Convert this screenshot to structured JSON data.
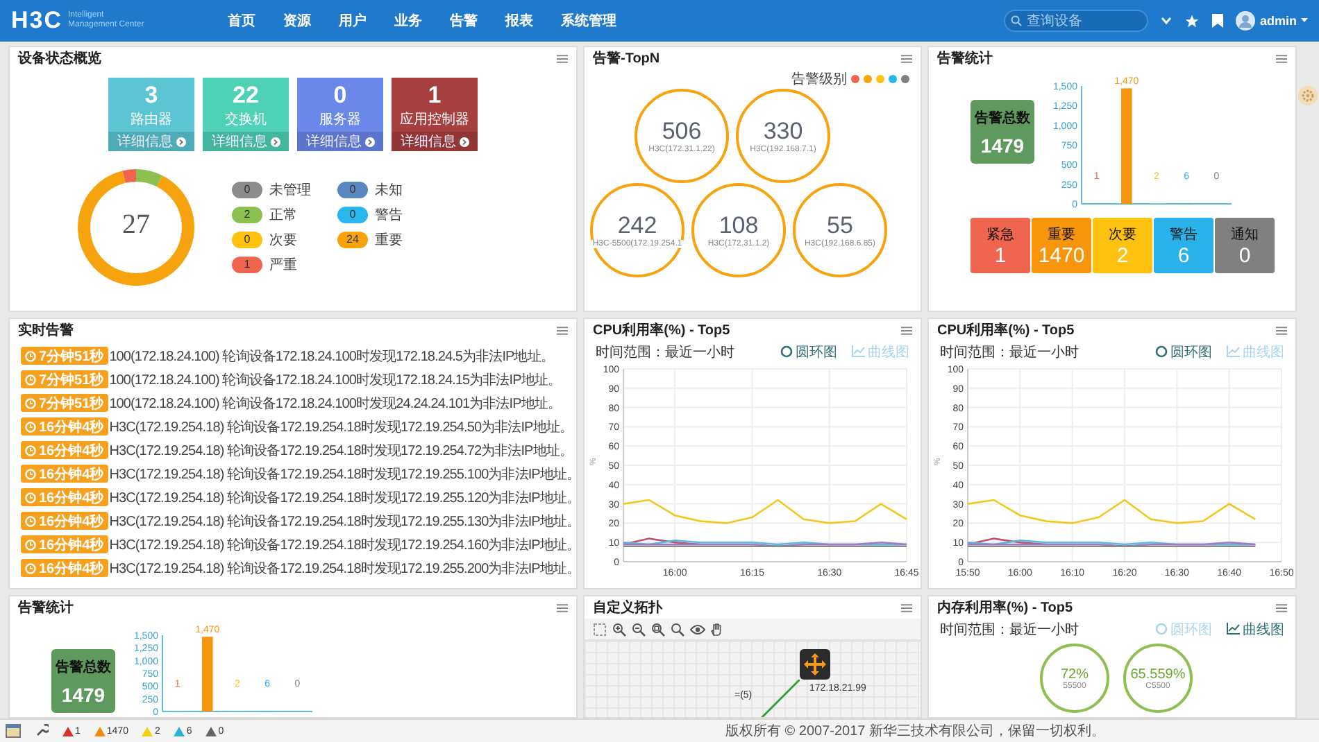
{
  "header": {
    "logo": "H3C",
    "logo_line_1": "Intelligent",
    "logo_line_2": "Management Center",
    "nav": [
      "首页",
      "资源",
      "用户",
      "业务",
      "告警",
      "报表",
      "系统管理"
    ],
    "search": {
      "placeholder": "查询设备"
    },
    "user": "admin"
  },
  "device_overview": {
    "title": "设备状态概览",
    "tiles": [
      {
        "count": "3",
        "label": "路由器",
        "link": "详细信息",
        "color": "#5bc5d3"
      },
      {
        "count": "22",
        "label": "交换机",
        "link": "详细信息",
        "color": "#4ed1b5"
      },
      {
        "count": "0",
        "label": "服务器",
        "link": "详细信息",
        "color": "#6a87ea"
      },
      {
        "count": "1",
        "label": "应用控制器",
        "link": "详细信息",
        "color": "#a83f3f"
      }
    ],
    "total": "27",
    "legend": [
      {
        "count": "0",
        "label": "未管理",
        "color": "#8c8c8c"
      },
      {
        "count": "0",
        "label": "未知",
        "color": "#5b87c0"
      },
      {
        "count": "2",
        "label": "正常",
        "color": "#8cc152"
      },
      {
        "count": "0",
        "label": "警告",
        "color": "#29b6ea"
      },
      {
        "count": "0",
        "label": "次要",
        "color": "#fdc20f"
      },
      {
        "count": "24",
        "label": "重要",
        "color": "#f7a30d"
      },
      {
        "count": "1",
        "label": "严重",
        "color": "#f0654f"
      }
    ]
  },
  "alarm_topn": {
    "title": "告警-TopN",
    "legend_label": "告警级别",
    "legend_dots": [
      {
        "color": "#f0654f"
      },
      {
        "color": "#f7a30d"
      },
      {
        "color": "#fdc20f"
      },
      {
        "color": "#29b6ea"
      },
      {
        "color": "#808080"
      }
    ],
    "devices": [
      {
        "count": "506",
        "name": "H3C(172.31.1.22)"
      },
      {
        "count": "330",
        "name": "H3C(192.168.7.1)"
      },
      {
        "count": "242",
        "name": "H3C-5500(172.19.254.1"
      },
      {
        "count": "108",
        "name": "H3C(172.31.1.2)"
      },
      {
        "count": "55",
        "name": "H3C(192.168.6.85)"
      }
    ]
  },
  "alarm_stats": {
    "title": "告警统计",
    "total_label": "告警总数",
    "total": "1479",
    "chart_data": {
      "type": "bar",
      "values": [
        1,
        1470,
        2,
        6,
        0
      ],
      "ylim": [
        0,
        1500
      ],
      "yticks": [
        0,
        250,
        500,
        750,
        {
          "value": 1000,
          "label": "1,000"
        },
        {
          "value": 1250,
          "label": "1,250"
        },
        {
          "value": 1500,
          "label": "1,500"
        }
      ],
      "value_labels": [
        "1",
        "1,470",
        "2",
        "6",
        "0"
      ]
    },
    "levels": [
      {
        "label": "紧急",
        "count": "1",
        "color": "#f0654f"
      },
      {
        "label": "重要",
        "count": "1470",
        "color": "#f7950d"
      },
      {
        "label": "次要",
        "count": "2",
        "color": "#fdc20f"
      },
      {
        "label": "警告",
        "count": "6",
        "color": "#29b1ea"
      },
      {
        "label": "通知",
        "count": "0",
        "color": "#808080"
      }
    ]
  },
  "realtime_alarms": {
    "title": "实时告警",
    "items": [
      {
        "age": "7分钟51秒",
        "message": "100(172.18.24.100) 轮询设备172.18.24.100时发现172.18.24.5为非法IP地址。"
      },
      {
        "age": "7分钟51秒",
        "message": "100(172.18.24.100) 轮询设备172.18.24.100时发现172.18.24.15为非法IP地址。"
      },
      {
        "age": "7分钟51秒",
        "message": "100(172.18.24.100) 轮询设备172.18.24.100时发现24.24.24.101为非法IP地址。"
      },
      {
        "age": "16分钟4秒",
        "message": "H3C(172.19.254.18) 轮询设备172.19.254.18时发现172.19.254.50为非法IP地址。"
      },
      {
        "age": "16分钟4秒",
        "message": "H3C(172.19.254.18) 轮询设备172.19.254.18时发现172.19.254.72为非法IP地址。"
      },
      {
        "age": "16分钟4秒",
        "message": "H3C(172.19.254.18) 轮询设备172.19.254.18时发现172.19.255.100为非法IP地址。"
      },
      {
        "age": "16分钟4秒",
        "message": "H3C(172.19.254.18) 轮询设备172.19.254.18时发现172.19.255.120为非法IP地址。"
      },
      {
        "age": "16分钟4秒",
        "message": "H3C(172.19.254.18) 轮询设备172.19.254.18时发现172.19.255.130为非法IP地址。"
      },
      {
        "age": "16分钟4秒",
        "message": "H3C(172.19.254.18) 轮询设备172.19.254.18时发现172.19.254.160为非法IP地址。"
      },
      {
        "age": "16分钟4秒",
        "message": "H3C(172.19.254.18) 轮询设备172.19.254.18时发现172.19.255.200为非法IP地址。"
      }
    ]
  },
  "cpu_panels": [
    {
      "title": "CPU利用率(%) - Top5",
      "time_range": "时间范围：最近一小时",
      "view_buttons": [
        {
          "label": "圆环图",
          "kind": "ring",
          "selected": false
        },
        {
          "label": "曲线图",
          "kind": "curve",
          "selected": true
        }
      ],
      "chart_data": {
        "type": "line",
        "grid": true,
        "ylabel": "%",
        "categories": [
          null,
          null,
          "16:00",
          null,
          null,
          "16:15",
          null,
          null,
          "16:30",
          null,
          null,
          "16:45"
        ],
        "ylim": [
          0,
          100
        ],
        "yticks": [
          0,
          10,
          20,
          30,
          40,
          50,
          60,
          70,
          80,
          90,
          100
        ],
        "series": [
          {
            "color": "#f2c81c",
            "values": [
              30,
              32,
              24,
              21,
              20,
              23,
              32,
              22,
              20,
              21,
              30,
              22
            ]
          },
          {
            "color": "#c0506e",
            "values": [
              9,
              12,
              10,
              9,
              null,
              null,
              null,
              null,
              null,
              null,
              null,
              null
            ]
          },
          {
            "color": "#5bb8e0",
            "values": [
              10,
              9,
              11,
              10,
              10,
              10,
              9,
              10,
              9,
              9,
              9,
              9
            ]
          },
          {
            "color": "#a07cc0",
            "values": [
              9,
              9,
              9,
              9,
              9,
              9,
              8,
              9,
              9,
              9,
              10,
              9
            ]
          },
          {
            "color": "#8a8a8a",
            "values": [
              8,
              8,
              8,
              8,
              8,
              8,
              8,
              8,
              8,
              8,
              8,
              8
            ]
          }
        ]
      }
    },
    {
      "title": "CPU利用率(%) - Top5",
      "time_range": "时间范围：最近一小时",
      "view_buttons": [
        {
          "label": "圆环图",
          "kind": "ring",
          "selected": false
        },
        {
          "label": "曲线图",
          "kind": "curve",
          "selected": true
        }
      ],
      "chart_data": {
        "type": "line",
        "grid": true,
        "ylabel": "%",
        "categories": [
          "15:50",
          null,
          "16:00",
          null,
          "16:10",
          null,
          "16:20",
          null,
          "16:30",
          null,
          "16:40",
          null,
          "16:50"
        ],
        "ylim": [
          0,
          100
        ],
        "yticks": [
          0,
          10,
          20,
          30,
          40,
          50,
          60,
          70,
          80,
          90,
          100
        ],
        "series": [
          {
            "color": "#f2c81c",
            "values": [
              30,
              32,
              24,
              21,
              20,
              23,
              32,
              22,
              20,
              21,
              30,
              22,
              null
            ]
          },
          {
            "color": "#c0506e",
            "values": [
              9,
              12,
              10,
              9,
              null,
              null,
              null,
              null,
              null,
              null,
              null,
              null,
              null
            ]
          },
          {
            "color": "#5bb8e0",
            "values": [
              10,
              9,
              11,
              10,
              10,
              10,
              9,
              10,
              9,
              9,
              9,
              9,
              null
            ]
          },
          {
            "color": "#a07cc0",
            "values": [
              9,
              9,
              9,
              9,
              9,
              9,
              8,
              9,
              9,
              9,
              10,
              9,
              null
            ]
          },
          {
            "color": "#8a8a8a",
            "values": [
              8,
              8,
              8,
              8,
              8,
              8,
              8,
              8,
              8,
              8,
              8,
              8,
              null
            ]
          }
        ]
      }
    }
  ],
  "alarm_stats_bottom": {
    "title": "告警统计",
    "total_label": "告警总数",
    "total": "1479",
    "chart_data": {
      "type": "bar",
      "values": [
        1,
        1470,
        2,
        6,
        0
      ],
      "ylim": [
        0,
        1500
      ],
      "yticks": [
        0,
        250,
        500,
        750,
        {
          "value": 1000,
          "label": "1,000"
        },
        {
          "value": 1250,
          "label": "1,250"
        },
        {
          "value": 1500,
          "label": "1,500"
        }
      ],
      "value_labels": [
        "1",
        "1,470",
        "2",
        "6",
        "0"
      ]
    }
  },
  "topology": {
    "title": "自定义拓扑",
    "link_label": "=(5)",
    "node_label": "172.18.21.99"
  },
  "memory_panel": {
    "title": "内存利用率(%) - Top5",
    "time_range": "时间范围：最近一小时",
    "view_buttons": [
      {
        "label": "圆环图",
        "kind": "ring",
        "selected": true
      },
      {
        "label": "曲线图",
        "kind": "curve",
        "selected": false
      }
    ],
    "gauges": [
      {
        "value": "72%",
        "name": "55500"
      },
      {
        "value": "65.559%",
        "name": "C5500"
      }
    ]
  },
  "status_bar": {
    "alarm_counts": [
      {
        "count": "1",
        "color": "#d9302c"
      },
      {
        "count": "1470",
        "color": "#f08a0c"
      },
      {
        "count": "2",
        "color": "#f3d20f"
      },
      {
        "count": "6",
        "color": "#2bb3d6"
      },
      {
        "count": "0",
        "color": "#666666"
      }
    ],
    "copyright": "版权所有 © 2007-2017 新华三技术有限公司，保留一切权利。"
  }
}
